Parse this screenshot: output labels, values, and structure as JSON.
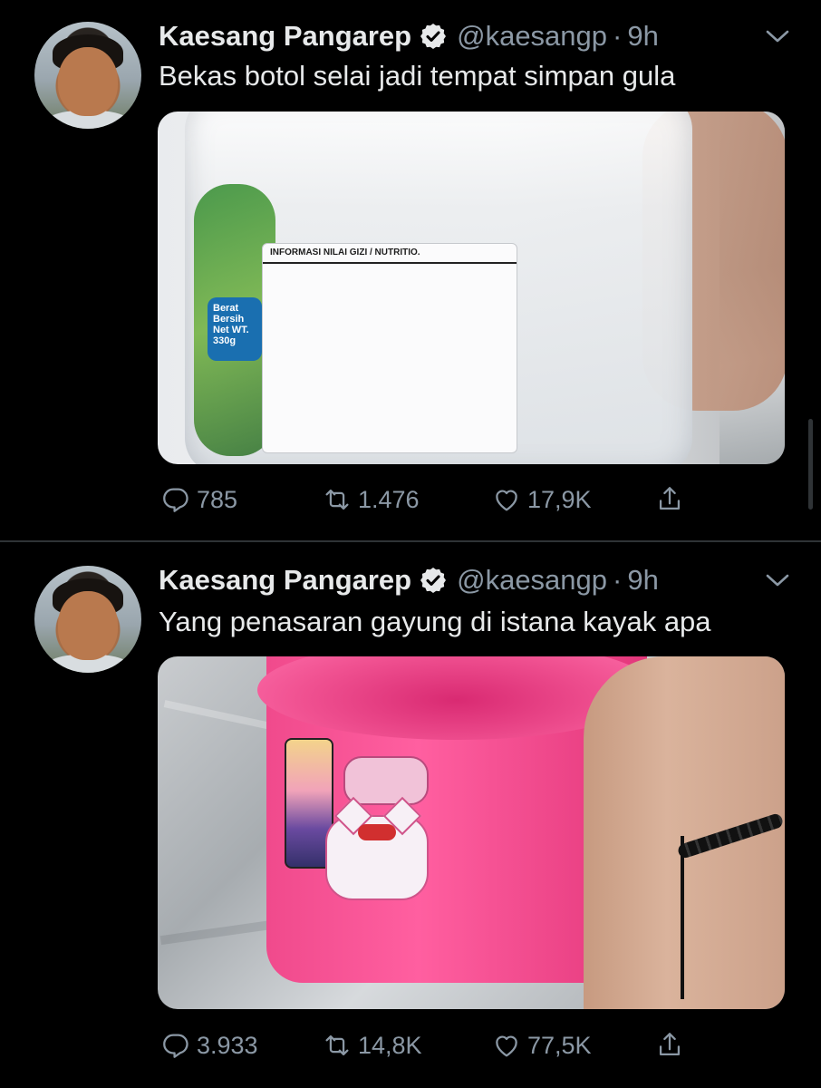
{
  "tweets": [
    {
      "author": {
        "name": "Kaesang Pangarep",
        "handle": "@kaesangp",
        "time": "9h",
        "dot": "·"
      },
      "text": "Bekas botol selai jadi tempat simpan gula",
      "media": {
        "label_title": "INFORMASI NILAI GIZI / NUTRITIO.",
        "net_weight": "Berat Bersih Net WT. 330g"
      },
      "stats": {
        "replies": "785",
        "retweets": "1.476",
        "likes": "17,9K"
      }
    },
    {
      "author": {
        "name": "Kaesang Pangarep",
        "handle": "@kaesangp",
        "time": "9h",
        "dot": "·"
      },
      "text": "Yang penasaran gayung di istana kayak apa",
      "stats": {
        "replies": "3.933",
        "retweets": "14,8K",
        "likes": "77,5K"
      }
    }
  ],
  "colors": {
    "background": "#000000",
    "text": "#e7e9ea",
    "muted": "#8b98a5",
    "divider": "#2f3336"
  },
  "icons": [
    "verified-badge-icon",
    "chevron-down-icon",
    "reply-icon",
    "retweet-icon",
    "like-icon",
    "share-icon"
  ]
}
